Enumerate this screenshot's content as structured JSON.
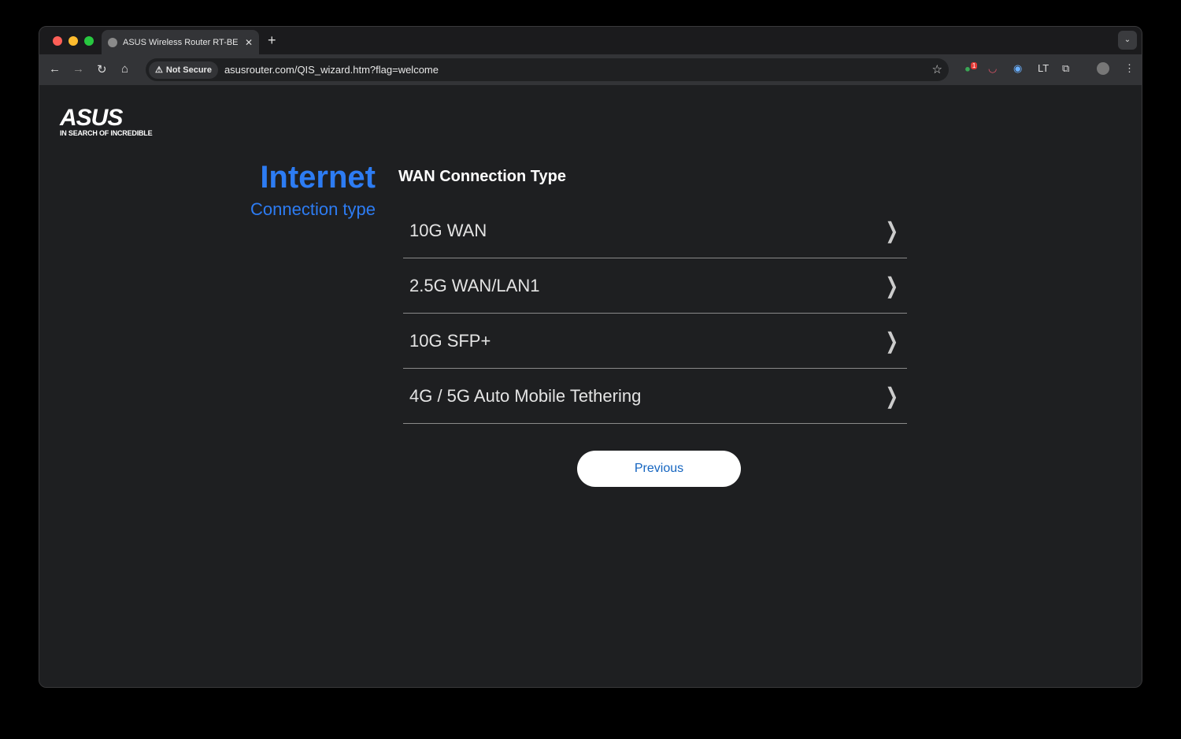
{
  "browser": {
    "tab_title": "ASUS Wireless Router RT-BE",
    "new_tab": "+",
    "security_chip": "Not Secure",
    "url": "asusrouter.com/QIS_wizard.htm?flag=welcome",
    "extension_badge": "1"
  },
  "logo": {
    "word": "ASUS",
    "tagline": "IN SEARCH OF INCREDIBLE"
  },
  "side": {
    "title": "Internet",
    "subtitle": "Connection type"
  },
  "main": {
    "heading": "WAN Connection Type",
    "options": [
      {
        "label": "10G WAN"
      },
      {
        "label": "2.5G WAN/LAN1"
      },
      {
        "label": "10G SFP+"
      },
      {
        "label": "4G / 5G Auto Mobile Tethering"
      }
    ],
    "previous_label": "Previous"
  },
  "colors": {
    "accent": "#2d7cf3",
    "background": "#1e1f21",
    "button_text": "#1565c0"
  }
}
